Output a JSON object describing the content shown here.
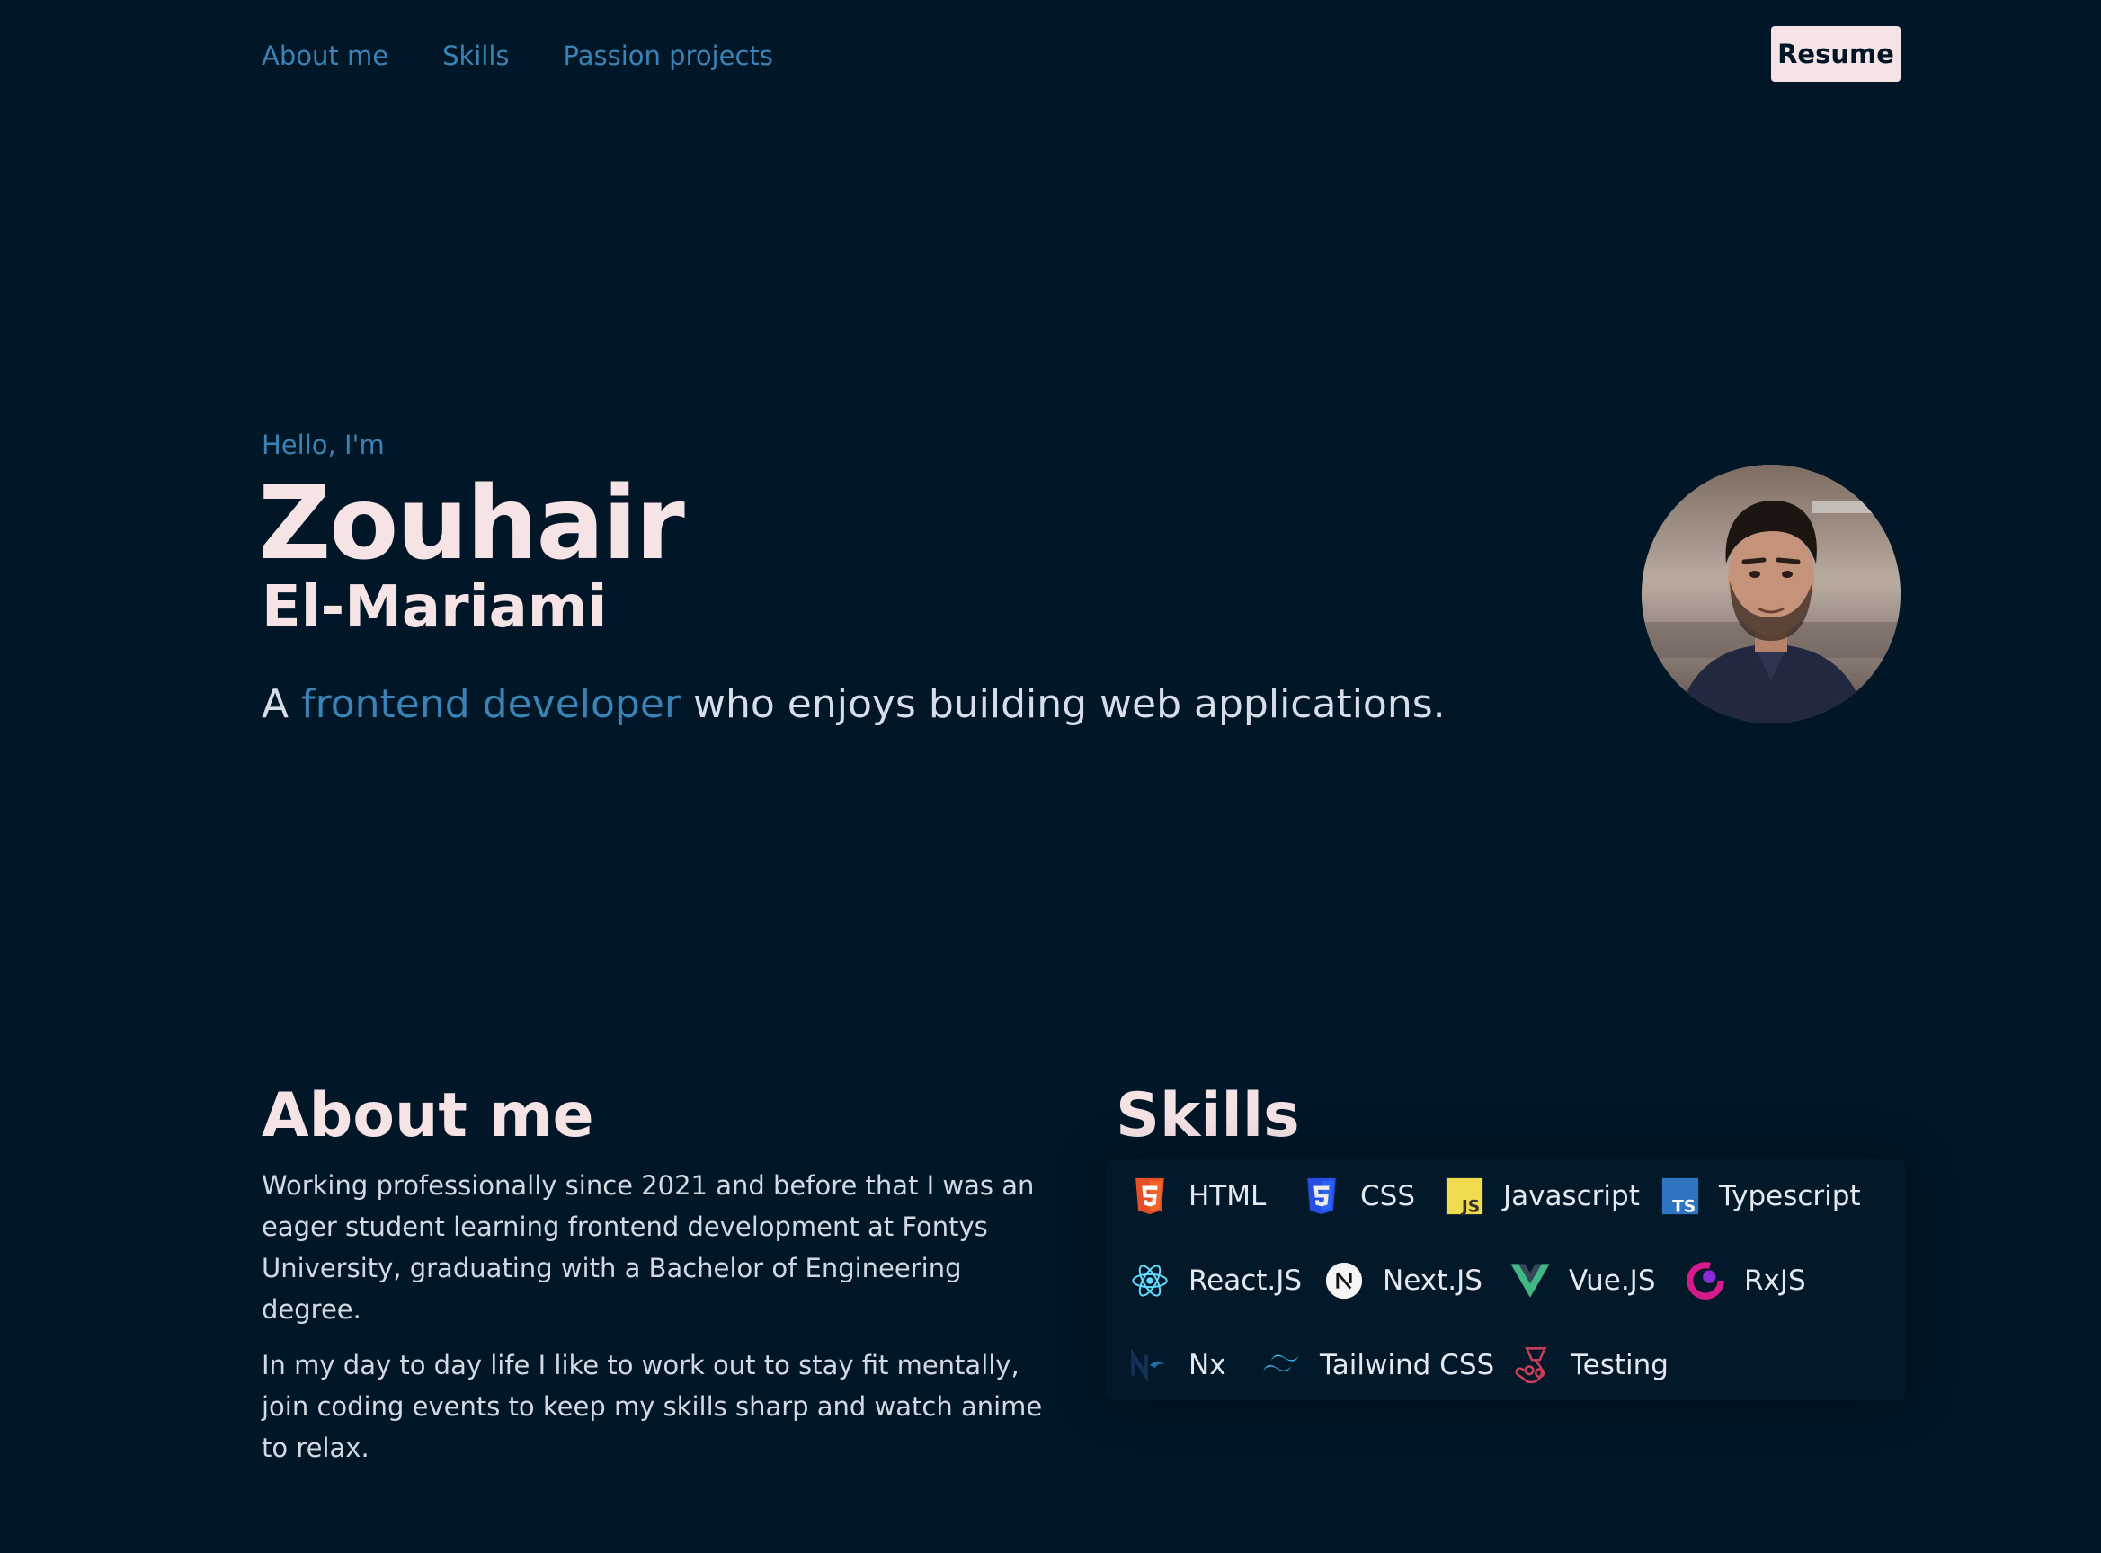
{
  "nav": {
    "items": [
      "About me",
      "Skills",
      "Passion projects"
    ],
    "resume_label": "Resume"
  },
  "hero": {
    "greeting": "Hello, I'm",
    "first_name": "Zouhair",
    "last_name": "El-Mariami",
    "tagline_prefix": "A",
    "tagline_accent": "frontend developer",
    "tagline_suffix": "who enjoys building web applications."
  },
  "about": {
    "title": "About me",
    "paragraphs": [
      "Working professionally since 2021 and before that I was an eager student learning frontend development at Fontys University, graduating with a Bachelor of Engineering degree.",
      "In my day to day life I like to work out to stay fit mentally, join coding events to keep my skills sharp and watch anime to relax."
    ]
  },
  "skills": {
    "title": "Skills",
    "items": [
      {
        "label": "HTML",
        "icon": "html5-icon"
      },
      {
        "label": "CSS",
        "icon": "css3-icon"
      },
      {
        "label": "Javascript",
        "icon": "javascript-icon"
      },
      {
        "label": "Typescript",
        "icon": "typescript-icon"
      },
      {
        "label": "React.JS",
        "icon": "react-icon"
      },
      {
        "label": "Next.JS",
        "icon": "nextjs-icon"
      },
      {
        "label": "Vue.JS",
        "icon": "vue-icon"
      },
      {
        "label": "RxJS",
        "icon": "rxjs-icon"
      },
      {
        "label": "Nx",
        "icon": "nx-icon"
      },
      {
        "label": "Tailwind CSS",
        "icon": "tailwind-icon"
      },
      {
        "label": "Testing",
        "icon": "jest-icon"
      }
    ]
  },
  "colors": {
    "background": "#011627",
    "accent": "#3b82b5",
    "text": "#f5e3e6"
  }
}
